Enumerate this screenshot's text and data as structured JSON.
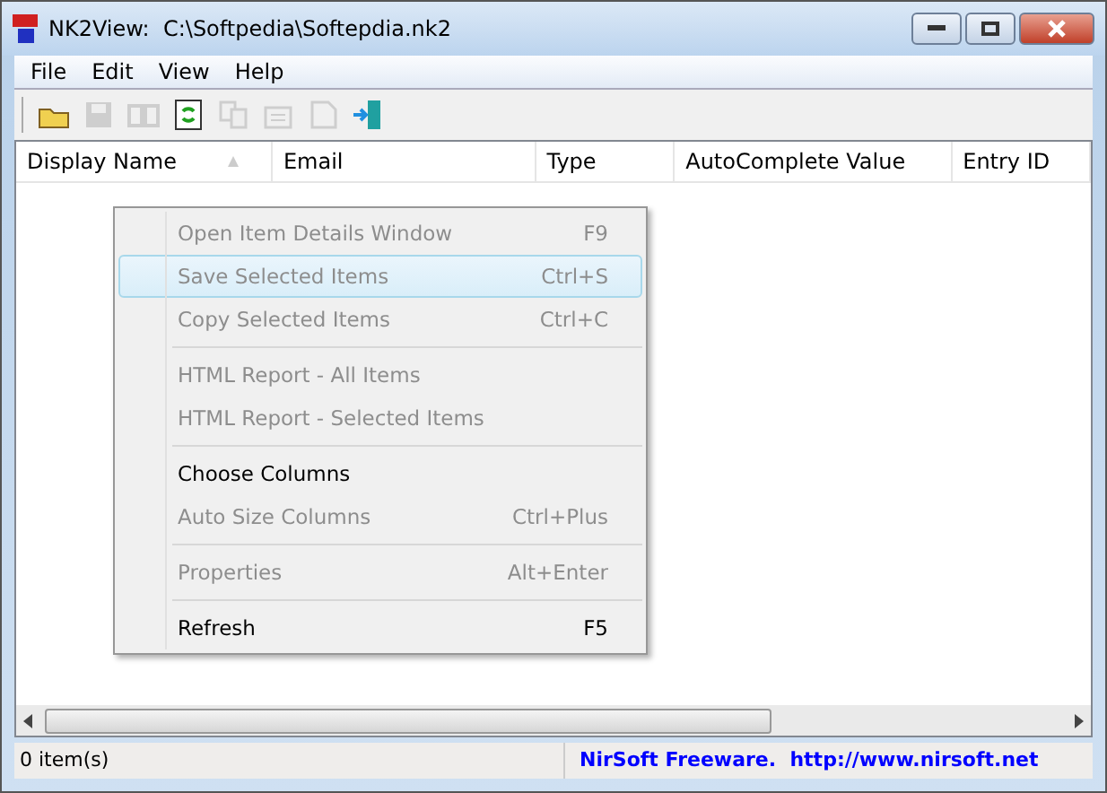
{
  "window": {
    "title": "NK2View:  C:\\Softpedia\\Softepdia.nk2"
  },
  "menu_bar": [
    "File",
    "Edit",
    "View",
    "Help"
  ],
  "toolbar": [
    {
      "kind": "open",
      "disabled": false
    },
    {
      "kind": "save",
      "disabled": true
    },
    {
      "kind": "book",
      "disabled": true
    },
    {
      "kind": "refresh",
      "disabled": false
    },
    {
      "kind": "copy",
      "disabled": true
    },
    {
      "kind": "properties",
      "disabled": true
    },
    {
      "kind": "report",
      "disabled": true
    },
    {
      "kind": "exit",
      "disabled": false
    }
  ],
  "table": {
    "columns": [
      {
        "label": "Display Name",
        "sorted": true
      },
      {
        "label": "Email",
        "sorted": false
      },
      {
        "label": "Type",
        "sorted": false
      },
      {
        "label": "AutoComplete Value",
        "sorted": false
      },
      {
        "label": "Entry ID",
        "sorted": false
      }
    ]
  },
  "context_menu": [
    {
      "kind": "item",
      "label": "Open Item Details Window",
      "shortcut": "F9",
      "disabled": true,
      "selected": false
    },
    {
      "kind": "item",
      "label": "Save Selected Items",
      "shortcut": "Ctrl+S",
      "disabled": true,
      "selected": true
    },
    {
      "kind": "item",
      "label": "Copy Selected Items",
      "shortcut": "Ctrl+C",
      "disabled": true,
      "selected": false
    },
    {
      "kind": "separator"
    },
    {
      "kind": "item",
      "label": "HTML Report - All Items",
      "disabled": true,
      "selected": false
    },
    {
      "kind": "item",
      "label": "HTML Report - Selected Items",
      "disabled": true,
      "selected": false
    },
    {
      "kind": "separator"
    },
    {
      "kind": "item",
      "label": "Choose Columns",
      "disabled": false,
      "selected": false
    },
    {
      "kind": "item",
      "label": "Auto Size Columns",
      "shortcut": "Ctrl+Plus",
      "disabled": true,
      "selected": false
    },
    {
      "kind": "separator"
    },
    {
      "kind": "item",
      "label": "Properties",
      "shortcut": "Alt+Enter",
      "disabled": true,
      "selected": false
    },
    {
      "kind": "separator"
    },
    {
      "kind": "item",
      "label": "Refresh",
      "shortcut": "F5",
      "disabled": false,
      "selected": false
    }
  ],
  "status_bar": {
    "count": "0 item(s)",
    "link": "NirSoft Freeware.  http://www.nirsoft.net"
  }
}
